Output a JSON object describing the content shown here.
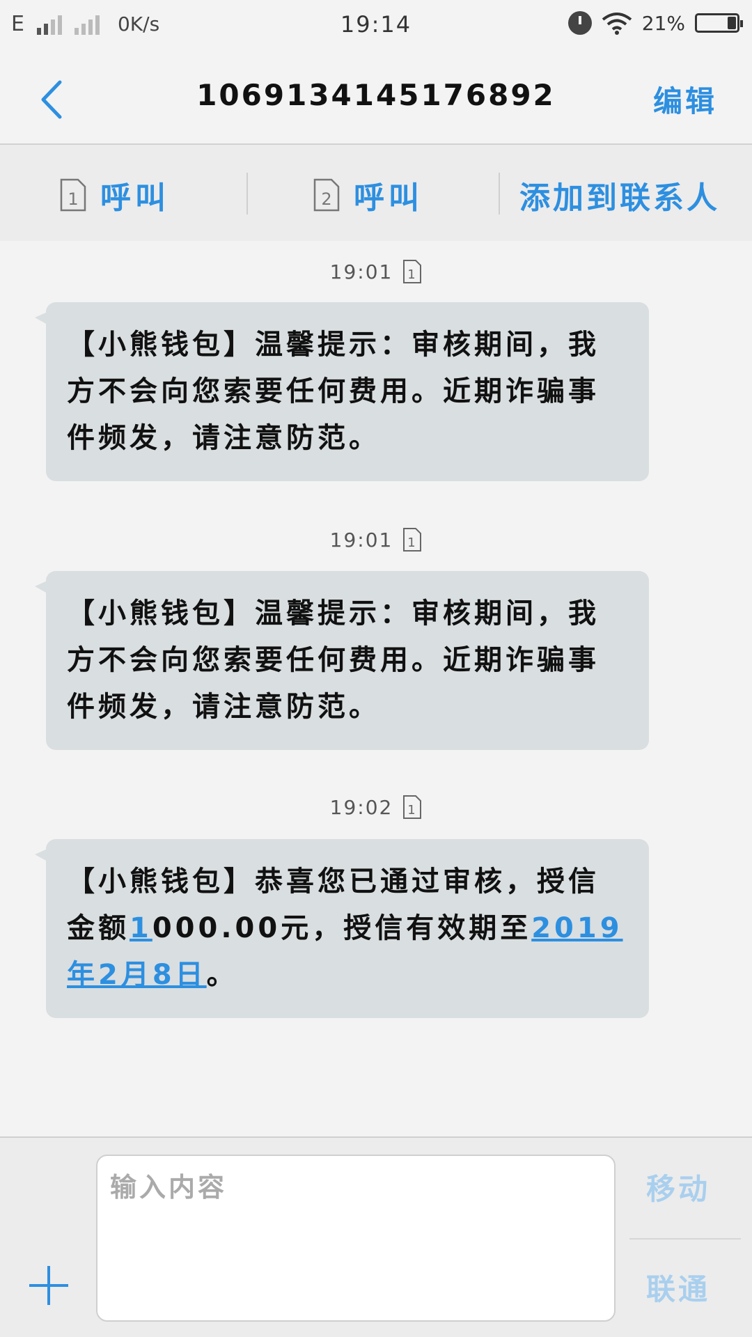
{
  "status_bar": {
    "network": "E",
    "speed": "0K/s",
    "time": "19:14",
    "battery": "21%"
  },
  "header": {
    "title": "1069134145176892",
    "edit_label": "编辑"
  },
  "actions": {
    "sim1_number": "1",
    "sim1_label": "呼叫",
    "sim2_number": "2",
    "sim2_label": "呼叫",
    "add_contact_label": "添加到联系人"
  },
  "messages": [
    {
      "time": "19:01",
      "sim": "1",
      "text": "【小熊钱包】温馨提示：审核期间，我方不会向您索要任何费用。近期诈骗事件频发，请注意防范。"
    },
    {
      "time": "19:01",
      "sim": "1",
      "text": "【小熊钱包】温馨提示：审核期间，我方不会向您索要任何费用。近期诈骗事件频发，请注意防范。"
    },
    {
      "time": "19:02",
      "sim": "1",
      "text_before": "【小熊钱包】恭喜您已通过审核，授信金额",
      "link_digit": "1",
      "text_middle": "000.00元，授信有效期至",
      "link_date": "2019年2月8日",
      "text_after": "。"
    }
  ],
  "composer": {
    "placeholder": "输入内容",
    "send_carrier1": "移动",
    "send_carrier2": "联通"
  },
  "colors": {
    "accent": "#2d8fe0",
    "bubble": "#d9dee0",
    "send_disabled": "#a9cfee"
  }
}
